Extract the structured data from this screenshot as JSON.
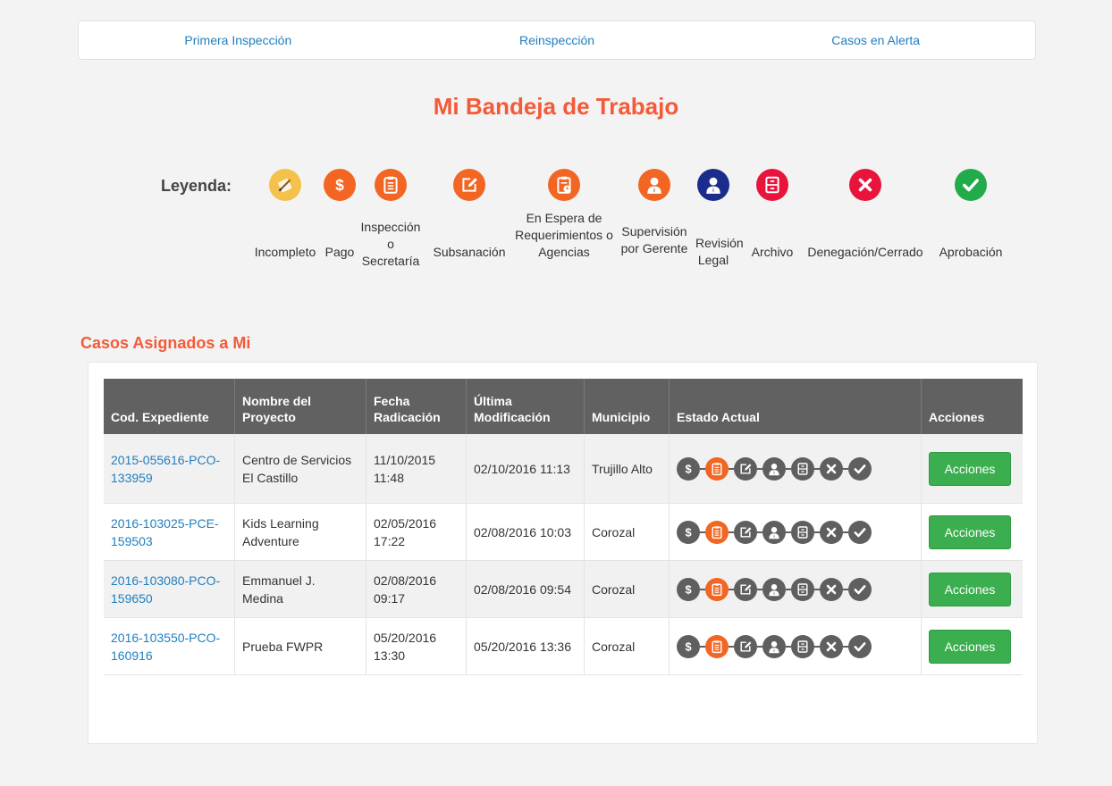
{
  "nav": {
    "tabs": [
      "Primera Inspección",
      "Reinspección",
      "Casos en Alerta"
    ]
  },
  "page_title": "Mi Bandeja de Trabajo",
  "legend": {
    "label": "Leyenda:",
    "items": [
      {
        "icon": "pencil-document-icon",
        "color": "#f4c14a",
        "text": "Incompleto"
      },
      {
        "icon": "dollar-icon",
        "color": "#f26522",
        "text": "Pago"
      },
      {
        "icon": "clipboard-icon",
        "color": "#f26522",
        "text": "Inspección o Secretaría"
      },
      {
        "icon": "edit-icon",
        "color": "#f26522",
        "text": "Subsanación"
      },
      {
        "icon": "clipboard-clock-icon",
        "color": "#f26522",
        "text": "En Espera de Requerimientos o Agencias"
      },
      {
        "icon": "manager-icon",
        "color": "#f26522",
        "text": "Supervisión por Gerente"
      },
      {
        "icon": "legal-user-icon",
        "color": "#1c2c8c",
        "text": "Revisión Legal"
      },
      {
        "icon": "archive-icon",
        "color": "#e8143c",
        "text": "Archivo"
      },
      {
        "icon": "x-icon",
        "color": "#e8143c",
        "text": "Denegación/Cerrado"
      },
      {
        "icon": "check-icon",
        "color": "#21ab4a",
        "text": "Aprobación"
      }
    ]
  },
  "section_title": "Casos Asignados a Mi",
  "table": {
    "headers": [
      "Cod. Expediente",
      "Nombre del Proyecto",
      "Fecha Radicación",
      "Última Modificación",
      "Municipio",
      "Estado Actual",
      "Acciones"
    ],
    "status_icons": [
      "dollar-icon",
      "clipboard-icon",
      "edit-icon",
      "manager-icon",
      "archive-icon",
      "x-icon",
      "check-icon"
    ],
    "active_color": "#f26522",
    "inactive_color": "#5f5f5f",
    "rows": [
      {
        "code": "2015-055616-PCO-133959",
        "project": "Centro de Servicios El Castillo",
        "filed": "11/10/2015 11:48",
        "modified": "02/10/2016 11:13",
        "municipio": "Trujillo Alto",
        "active_step": 1,
        "action": "Acciones"
      },
      {
        "code": "2016-103025-PCE-159503",
        "project": "Kids Learning Adventure",
        "filed": "02/05/2016 17:22",
        "modified": "02/08/2016 10:03",
        "municipio": "Corozal",
        "active_step": 1,
        "action": "Acciones"
      },
      {
        "code": "2016-103080-PCO-159650",
        "project": "Emmanuel J. Medina",
        "filed": "02/08/2016 09:17",
        "modified": "02/08/2016 09:54",
        "municipio": "Corozal",
        "active_step": 1,
        "action": "Acciones"
      },
      {
        "code": "2016-103550-PCO-160916",
        "project": "Prueba FWPR",
        "filed": "05/20/2016 13:30",
        "modified": "05/20/2016 13:36",
        "municipio": "Corozal",
        "active_step": 1,
        "action": "Acciones"
      }
    ]
  }
}
